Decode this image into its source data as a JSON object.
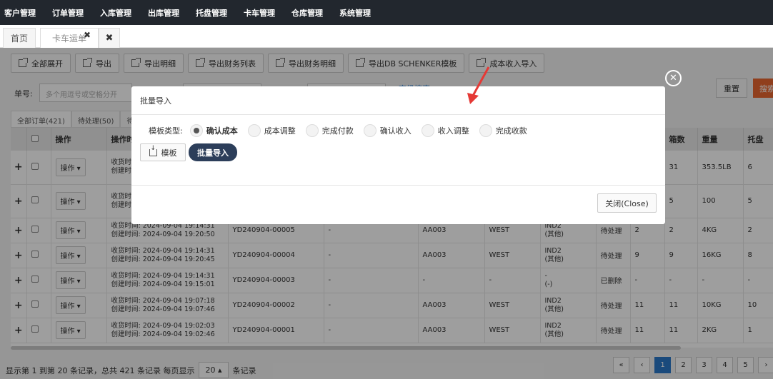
{
  "nav": [
    "客户管理",
    "订单管理",
    "入库管理",
    "出库管理",
    "托盘管理",
    "卡车管理",
    "仓库管理",
    "系统管理"
  ],
  "tabs": {
    "home": "首页",
    "active": "卡车运单",
    "active_close": "✖",
    "close_all": "✖"
  },
  "toolbar": [
    "全部展开",
    "导出",
    "导出明细",
    "导出财务列表",
    "导出财务明细",
    "导出DB SCHENKER模板",
    "成本收入导入"
  ],
  "filters": {
    "order_label": "单号:",
    "order_placeholder": "多个用逗号或空格分开",
    "reset": "重置",
    "search": "搜索",
    "advanced": "高级搜索"
  },
  "subtabs": [
    "全部订单(421)",
    "待处理(50)",
    "待提"
  ],
  "table": {
    "headers": [
      "",
      "",
      "操作",
      "操作时",
      "",
      "",
      "",
      "",
      "",
      "",
      "",
      "箱数",
      "重量",
      "托盘"
    ],
    "op_label": "操作",
    "rows": [
      {
        "time1": "收货时间:",
        "time2": "创建时间:",
        "no": "",
        "c1": "",
        "c2": "",
        "c3": "",
        "c4": "",
        "status": "",
        "a": "",
        "box": "31",
        "weight": "353.5LB",
        "pallet": "6"
      },
      {
        "time1": "收货时间:",
        "time2": "创建时间:",
        "no": "",
        "c1": "",
        "c2": "",
        "c3": "",
        "c4": "",
        "status": "",
        "a": "",
        "box": "5",
        "weight": "100",
        "pallet": "5"
      },
      {
        "time1": "收货时间: 2024-09-04 19:14:31",
        "time2": "创建时间: 2024-09-04 19:20:50",
        "no": "YD240904-00005",
        "c1": "-",
        "c2": "AA003",
        "c3": "WEST",
        "c4": "IND2",
        "c4b": "(其他)",
        "status": "待处理",
        "a": "2",
        "box": "2",
        "weight": "4KG",
        "pallet": "2"
      },
      {
        "time1": "收货时间: 2024-09-04 19:14:31",
        "time2": "创建时间: 2024-09-04 19:20:45",
        "no": "YD240904-00004",
        "c1": "-",
        "c2": "AA003",
        "c3": "WEST",
        "c4": "IND2",
        "c4b": "(其他)",
        "status": "待处理",
        "a": "9",
        "box": "9",
        "weight": "16KG",
        "pallet": "8"
      },
      {
        "time1": "收货时间: 2024-09-04 19:14:31",
        "time2": "创建时间: 2024-09-04 19:15:01",
        "no": "YD240904-00003",
        "c1": "-",
        "c2": "-",
        "c3": "-",
        "c4": "-",
        "c4b": "(-)",
        "status": "已删除",
        "a": "-",
        "box": "-",
        "weight": "-",
        "pallet": "-"
      },
      {
        "time1": "收货时间: 2024-09-04 19:07:18",
        "time2": "创建时间: 2024-09-04 19:07:46",
        "no": "YD240904-00002",
        "c1": "-",
        "c2": "AA003",
        "c3": "WEST",
        "c4": "IND2",
        "c4b": "(其他)",
        "status": "待处理",
        "a": "11",
        "box": "11",
        "weight": "10KG",
        "pallet": "10"
      },
      {
        "time1": "收货时间: 2024-09-04 19:02:03",
        "time2": "创建时间: 2024-09-04 19:02:46",
        "no": "YD240904-00001",
        "c1": "-",
        "c2": "AA003",
        "c3": "WEST",
        "c4": "IND2",
        "c4b": "(其他)",
        "status": "待处理",
        "a": "11",
        "box": "11",
        "weight": "2KG",
        "pallet": "1"
      }
    ]
  },
  "pagination": {
    "info": "显示第 1 到第 20 条记录，总共 421 条记录 每页显示",
    "page_size": "20",
    "suffix": "条记录",
    "pages": [
      "«",
      "‹",
      "1",
      "2",
      "3",
      "4",
      "5",
      "›"
    ]
  },
  "modal": {
    "title": "批量导入",
    "type_label": "模板类型:",
    "options": [
      "确认成本",
      "成本调整",
      "完成付款",
      "确认收入",
      "收入调整",
      "完成收款"
    ],
    "template_btn": "模板",
    "import_btn": "批量导入",
    "close_btn": "关闭(Close)",
    "x": "✕"
  },
  "colors": {
    "nav_bg": "#22272e",
    "import_btn": "#2c3e5a",
    "page_active": "#2a78c8",
    "search_btn": "#e8672f",
    "arrow": "#e53935"
  }
}
